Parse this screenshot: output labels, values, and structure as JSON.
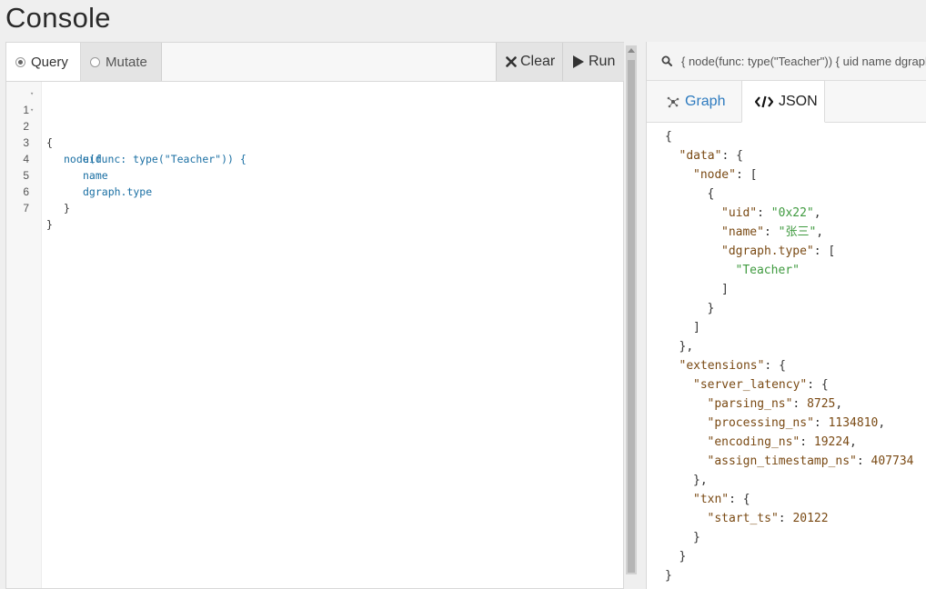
{
  "app": {
    "title": "Console"
  },
  "toolbar": {
    "query_label": "Query",
    "mutate_label": "Mutate",
    "clear_label": "Clear",
    "run_label": "Run"
  },
  "editor": {
    "lines": [
      {
        "num": "1",
        "text": "{"
      },
      {
        "num": "2",
        "text": "node(func: type(\"Teacher\")) {"
      },
      {
        "num": "3",
        "text": "uid"
      },
      {
        "num": "4",
        "text": "name"
      },
      {
        "num": "5",
        "text": "dgraph.type"
      },
      {
        "num": "6",
        "text": "}"
      },
      {
        "num": "7",
        "text": "}"
      }
    ]
  },
  "results": {
    "query_text": "{ node(func: type(\"Teacher\")) { uid name dgraph.type } }",
    "tabs": {
      "graph": "Graph",
      "json": "JSON"
    },
    "json_lines": [
      {
        "parts": [
          {
            "t": "p",
            "v": "{"
          }
        ]
      },
      {
        "parts": [
          {
            "t": "k",
            "v": "\"data\""
          },
          {
            "t": "p",
            "v": ": {"
          }
        ]
      },
      {
        "parts": [
          {
            "t": "k",
            "v": "\"node\""
          },
          {
            "t": "p",
            "v": ": ["
          }
        ]
      },
      {
        "parts": [
          {
            "t": "p",
            "v": "{"
          }
        ]
      },
      {
        "parts": [
          {
            "t": "k",
            "v": "\"uid\""
          },
          {
            "t": "p",
            "v": ": "
          },
          {
            "t": "s",
            "v": "\"0x22\""
          },
          {
            "t": "p",
            "v": ","
          }
        ]
      },
      {
        "parts": [
          {
            "t": "k",
            "v": "\"name\""
          },
          {
            "t": "p",
            "v": ": "
          },
          {
            "t": "s",
            "v": "\"张三\""
          },
          {
            "t": "p",
            "v": ","
          }
        ]
      },
      {
        "parts": [
          {
            "t": "k",
            "v": "\"dgraph.type\""
          },
          {
            "t": "p",
            "v": ": ["
          }
        ]
      },
      {
        "parts": [
          {
            "t": "s",
            "v": "\"Teacher\""
          }
        ]
      },
      {
        "parts": [
          {
            "t": "p",
            "v": "]"
          }
        ]
      },
      {
        "parts": [
          {
            "t": "p",
            "v": "}"
          }
        ]
      },
      {
        "parts": [
          {
            "t": "p",
            "v": "]"
          }
        ]
      },
      {
        "parts": [
          {
            "t": "p",
            "v": "},"
          }
        ]
      },
      {
        "parts": [
          {
            "t": "k",
            "v": "\"extensions\""
          },
          {
            "t": "p",
            "v": ": {"
          }
        ]
      },
      {
        "parts": [
          {
            "t": "k",
            "v": "\"server_latency\""
          },
          {
            "t": "p",
            "v": ": {"
          }
        ]
      },
      {
        "parts": [
          {
            "t": "k",
            "v": "\"parsing_ns\""
          },
          {
            "t": "p",
            "v": ": "
          },
          {
            "t": "n",
            "v": "8725"
          },
          {
            "t": "p",
            "v": ","
          }
        ]
      },
      {
        "parts": [
          {
            "t": "k",
            "v": "\"processing_ns\""
          },
          {
            "t": "p",
            "v": ": "
          },
          {
            "t": "n",
            "v": "1134810"
          },
          {
            "t": "p",
            "v": ","
          }
        ]
      },
      {
        "parts": [
          {
            "t": "k",
            "v": "\"encoding_ns\""
          },
          {
            "t": "p",
            "v": ": "
          },
          {
            "t": "n",
            "v": "19224"
          },
          {
            "t": "p",
            "v": ","
          }
        ]
      },
      {
        "parts": [
          {
            "t": "k",
            "v": "\"assign_timestamp_ns\""
          },
          {
            "t": "p",
            "v": ": "
          },
          {
            "t": "n",
            "v": "407734"
          }
        ]
      },
      {
        "parts": [
          {
            "t": "p",
            "v": "},"
          }
        ]
      },
      {
        "parts": [
          {
            "t": "k",
            "v": "\"txn\""
          },
          {
            "t": "p",
            "v": ": {"
          }
        ]
      },
      {
        "parts": [
          {
            "t": "k",
            "v": "\"start_ts\""
          },
          {
            "t": "p",
            "v": ": "
          },
          {
            "t": "n",
            "v": "20122"
          }
        ]
      },
      {
        "parts": [
          {
            "t": "p",
            "v": "}"
          }
        ]
      },
      {
        "parts": [
          {
            "t": "p",
            "v": "}"
          }
        ]
      },
      {
        "parts": [
          {
            "t": "p",
            "v": "}"
          }
        ]
      }
    ]
  },
  "colors": {
    "json_key": "#7a4a14",
    "json_string": "#3f9a3f",
    "keyword": "#1a6fa3",
    "graph_tab": "#2e7bbf"
  },
  "icons": {
    "clear": "close-icon",
    "run": "play-icon",
    "search": "search-icon",
    "graph": "graph-icon",
    "json": "code-icon"
  }
}
